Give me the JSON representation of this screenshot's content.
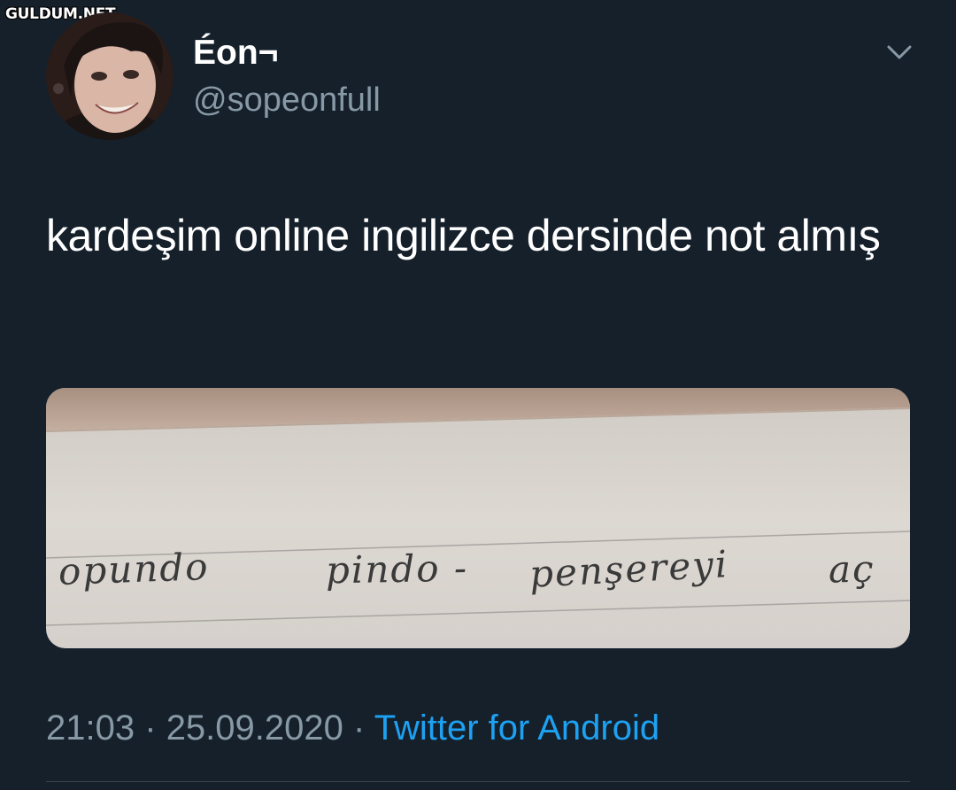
{
  "watermark": "GULDUM.NET",
  "tweet": {
    "display_name": "Éon¬",
    "handle": "@sopeonfull",
    "text": "kardeşim online ingilizce dersinde not almış",
    "media": {
      "handwriting": [
        "opundo",
        "pindo -",
        "penşereyi",
        "aç"
      ]
    },
    "time": "21:03",
    "separator": "·",
    "date": "25.09.2020",
    "source": "Twitter for Android"
  },
  "icons": {
    "more_menu": "chevron-down-icon",
    "avatar": "profile-avatar"
  },
  "colors": {
    "background": "#15202b",
    "primary_text": "#ffffff",
    "secondary_text": "#8899a6",
    "link": "#1da1f2",
    "divider": "#38444d"
  }
}
